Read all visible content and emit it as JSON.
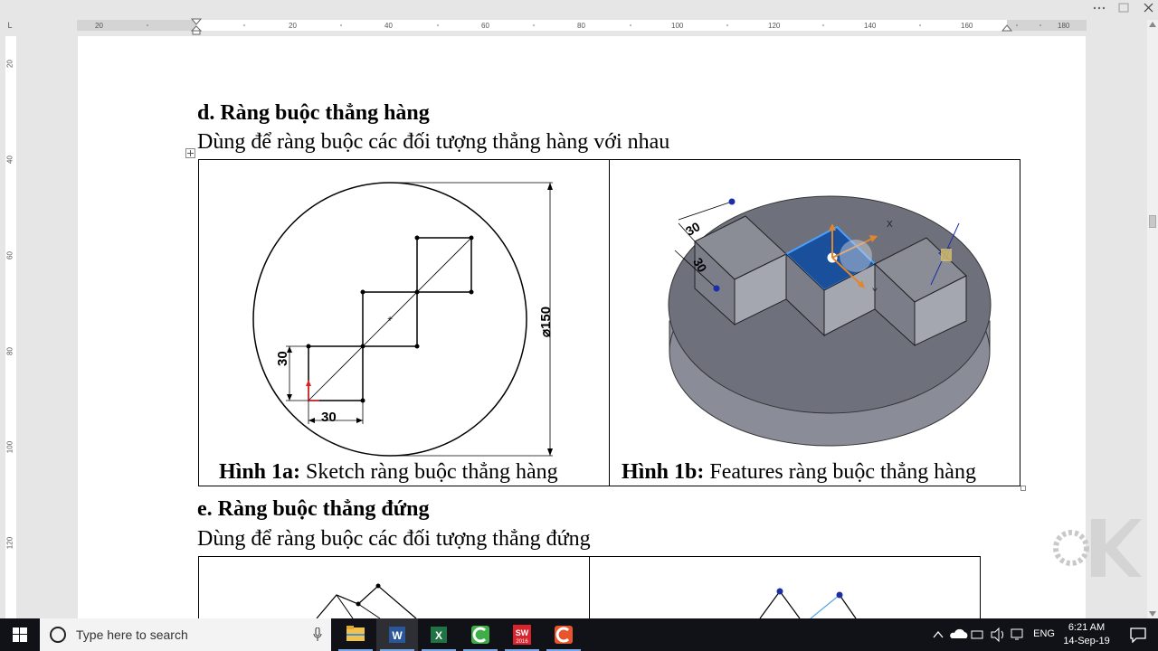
{
  "ruler": {
    "horizontal_labels": [
      "20",
      "20",
      "40",
      "60",
      "80",
      "100",
      "120",
      "140",
      "160",
      "180"
    ],
    "vertical_labels": [
      "20",
      "40",
      "60",
      "80",
      "100",
      "120"
    ],
    "corner": "L"
  },
  "document": {
    "section_d": {
      "heading": "d. Ràng buộc thẳng hàng",
      "body": "Dùng để ràng buộc các đối tượng thẳng hàng với nhau"
    },
    "figure_1a": {
      "caption_bold": "Hình 1a:",
      "caption_text": " Sketch ràng buộc thẳng hàng",
      "dim_height": "30",
      "dim_width": "30",
      "dim_diameter": "⌀150"
    },
    "figure_1b": {
      "caption_bold": "Hình 1b:",
      "caption_text": " Features ràng buộc thẳng hàng",
      "dim_top": "30",
      "dim_side": "30",
      "axis_x": "X",
      "axis_y": "Y"
    },
    "section_e": {
      "heading": "e. Ràng buộc thẳng đứng",
      "body": "Dùng để ràng buộc các đối tượng thẳng đứng"
    }
  },
  "taskbar": {
    "search_placeholder": "Type here to search",
    "apps": [
      {
        "name": "file-explorer",
        "color": "#f2c24b"
      },
      {
        "name": "word",
        "color": "#2b579a"
      },
      {
        "name": "excel",
        "color": "#217346"
      },
      {
        "name": "camtasia",
        "color": "#3fae49"
      },
      {
        "name": "solidworks",
        "color": "#d9232d",
        "badge": "2016"
      },
      {
        "name": "camtasia-recorder",
        "color": "#e8542b"
      }
    ],
    "language": "ENG",
    "time": "6:21 AM",
    "date": "14-Sep-19"
  },
  "colors": {
    "taskbar_bg": "#101217",
    "selected_face": "#1a4f9c",
    "solid_gray": "#8a8c96",
    "dimension_blue": "#1a2ea8"
  }
}
